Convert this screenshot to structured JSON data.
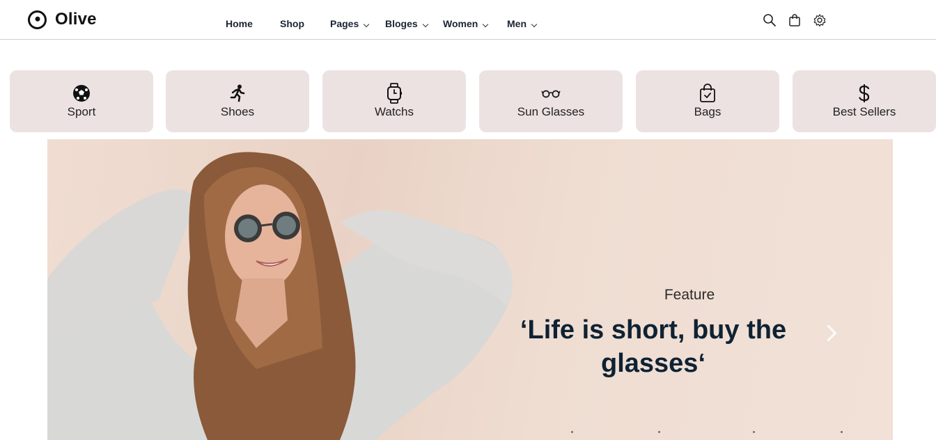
{
  "brand": {
    "name": "Olive"
  },
  "nav": [
    {
      "label": "Home",
      "dropdown": false
    },
    {
      "label": "Shop",
      "dropdown": false
    },
    {
      "label": "Pages",
      "dropdown": true
    },
    {
      "label": "Bloges",
      "dropdown": true
    },
    {
      "label": "Women",
      "dropdown": true
    },
    {
      "label": "Men",
      "dropdown": true
    }
  ],
  "header_icons": [
    "search-icon",
    "shopping-bag-icon",
    "settings-icon"
  ],
  "categories": [
    {
      "label": "Sport",
      "icon": "soccer-ball-icon"
    },
    {
      "label": "Shoes",
      "icon": "running-person-icon"
    },
    {
      "label": "Watchs",
      "icon": "watch-icon"
    },
    {
      "label": "Sun Glasses",
      "icon": "glasses-icon"
    },
    {
      "label": "Bags",
      "icon": "bag-check-icon"
    },
    {
      "label": "Best Sellers",
      "icon": "dollar-icon"
    }
  ],
  "banner": {
    "eyebrow": "Feature",
    "headline": "‘Life is short, buy the glasses‘"
  },
  "colors": {
    "category_bg": "#ede2e2",
    "headline": "#0e2233",
    "banner_bg": "#ecd8cc"
  }
}
